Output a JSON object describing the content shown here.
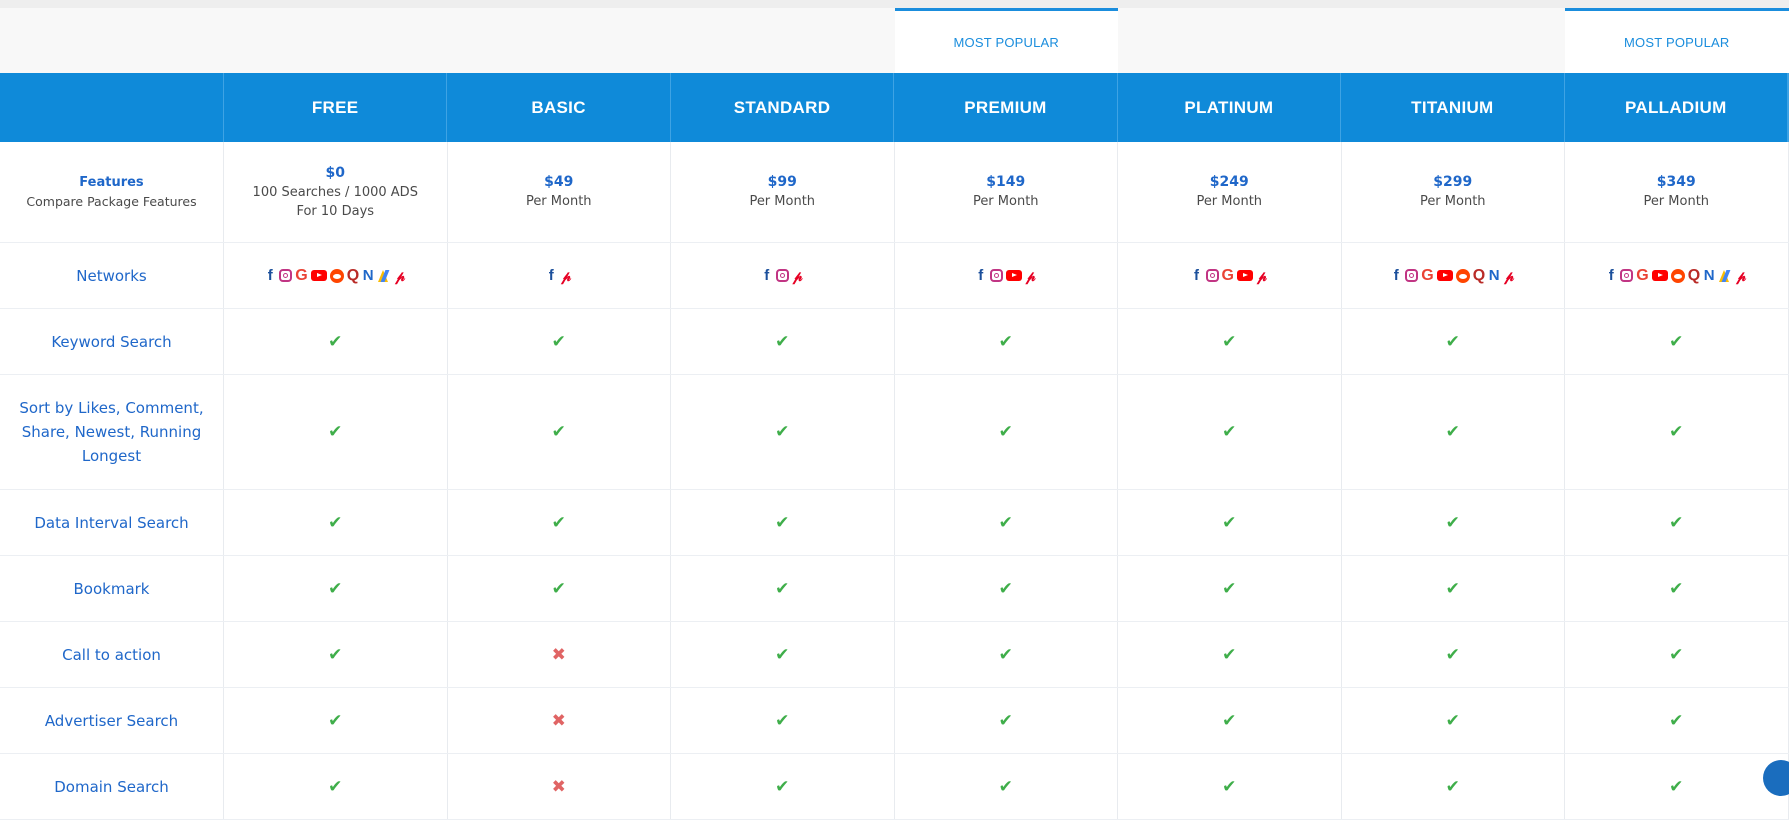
{
  "popular_label": "MOST POPULAR",
  "plans": [
    {
      "name": "FREE",
      "price": "$0",
      "line1": "100 Searches / 1000 ADS",
      "line2": "For 10 Days",
      "popular": false,
      "networks": [
        "facebook-icon",
        "instagram-icon",
        "google-icon",
        "youtube-icon",
        "reddit-icon",
        "quora-icon",
        "native-icon",
        "google-ads-icon",
        "pinterest-icon"
      ]
    },
    {
      "name": "BASIC",
      "price": "$49",
      "line1": "Per Month",
      "popular": false,
      "networks": [
        "facebook-icon",
        "pinterest-icon"
      ]
    },
    {
      "name": "STANDARD",
      "price": "$99",
      "line1": "Per Month",
      "popular": false,
      "networks": [
        "facebook-icon",
        "instagram-icon",
        "pinterest-icon"
      ]
    },
    {
      "name": "PREMIUM",
      "price": "$149",
      "line1": "Per Month",
      "popular": true,
      "networks": [
        "facebook-icon",
        "instagram-icon",
        "youtube-icon",
        "pinterest-icon"
      ]
    },
    {
      "name": "PLATINUM",
      "price": "$249",
      "line1": "Per Month",
      "popular": false,
      "networks": [
        "facebook-icon",
        "instagram-icon",
        "google-icon",
        "youtube-icon",
        "pinterest-icon"
      ]
    },
    {
      "name": "TITANIUM",
      "price": "$299",
      "line1": "Per Month",
      "popular": false,
      "networks": [
        "facebook-icon",
        "instagram-icon",
        "google-icon",
        "youtube-icon",
        "reddit-icon",
        "quora-icon",
        "native-icon",
        "pinterest-icon"
      ]
    },
    {
      "name": "PALLADIUM",
      "price": "$349",
      "line1": "Per Month",
      "popular": true,
      "networks": [
        "facebook-icon",
        "instagram-icon",
        "google-icon",
        "youtube-icon",
        "reddit-icon",
        "quora-icon",
        "native-icon",
        "google-ads-icon",
        "pinterest-icon"
      ]
    }
  ],
  "features_header": {
    "title": "Features",
    "subtitle": "Compare Package Features"
  },
  "networks_label": "Networks",
  "features": [
    {
      "label": "Keyword Search",
      "tall": false,
      "values": [
        true,
        true,
        true,
        true,
        true,
        true,
        true
      ]
    },
    {
      "label": "Sort by Likes, Comment, Share, Newest, Running Longest",
      "tall": true,
      "values": [
        true,
        true,
        true,
        true,
        true,
        true,
        true
      ]
    },
    {
      "label": "Data Interval Search",
      "tall": false,
      "values": [
        true,
        true,
        true,
        true,
        true,
        true,
        true
      ]
    },
    {
      "label": "Bookmark",
      "tall": false,
      "values": [
        true,
        true,
        true,
        true,
        true,
        true,
        true
      ]
    },
    {
      "label": "Call to action",
      "tall": false,
      "values": [
        true,
        false,
        true,
        true,
        true,
        true,
        true
      ]
    },
    {
      "label": "Advertiser Search",
      "tall": false,
      "values": [
        true,
        false,
        true,
        true,
        true,
        true,
        true
      ]
    },
    {
      "label": "Domain Search",
      "tall": false,
      "values": [
        true,
        false,
        true,
        true,
        true,
        true,
        true
      ]
    }
  ],
  "symbols": {
    "check": "✔",
    "cross": "✖"
  },
  "colors": {
    "accent": "#0f8ad9",
    "label_blue": "#1f67c9",
    "check_green": "#3fae4a",
    "cross_red": "#e06464"
  }
}
